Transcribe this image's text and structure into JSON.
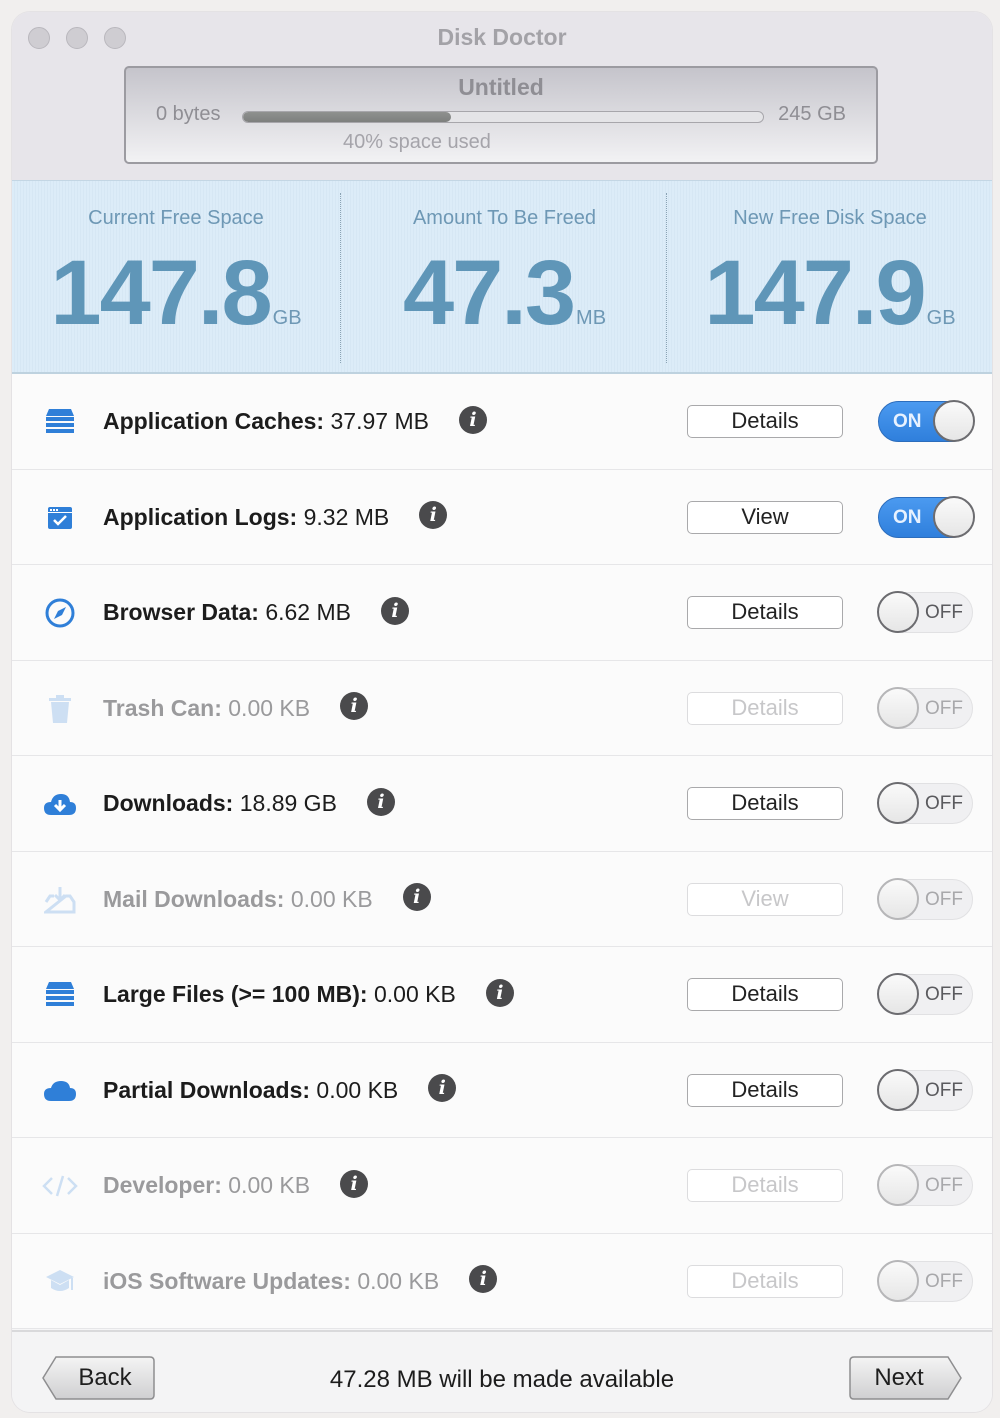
{
  "window": {
    "title": "Disk Doctor"
  },
  "disk": {
    "name": "Untitled",
    "min_label": "0 bytes",
    "max_label": "245 GB",
    "used_fraction": 0.4,
    "used_label": "40% space used"
  },
  "stats": [
    {
      "label": "Current Free Space",
      "value": "147.8",
      "unit": "GB"
    },
    {
      "label": "Amount To Be Freed",
      "value": "47.3",
      "unit": "MB"
    },
    {
      "label": "New Free Disk Space",
      "value": "147.9",
      "unit": "GB"
    }
  ],
  "items": [
    {
      "name": "Application Caches:",
      "size": " 37.97 MB",
      "icon": "server-stack-icon",
      "button": "Details",
      "toggle": "ON",
      "enabled": true
    },
    {
      "name": "Application Logs:",
      "size": " 9.32 MB",
      "icon": "checked-window-icon",
      "button": "View",
      "toggle": "ON",
      "enabled": true
    },
    {
      "name": "Browser Data:",
      "size": " 6.62 MB",
      "icon": "compass-icon",
      "button": "Details",
      "toggle": "OFF",
      "enabled": true
    },
    {
      "name": "Trash Can:",
      "size": " 0.00 KB",
      "icon": "trash-icon",
      "button": "Details",
      "toggle": "OFF",
      "enabled": false
    },
    {
      "name": "Downloads:",
      "size": " 18.89 GB",
      "icon": "cloud-download-icon",
      "button": "Details",
      "toggle": "OFF",
      "enabled": true
    },
    {
      "name": "Mail Downloads:",
      "size": " 0.00 KB",
      "icon": "tray-download-icon",
      "button": "View",
      "toggle": "OFF",
      "enabled": false
    },
    {
      "name": "Large Files (>= 100 MB):",
      "size": " 0.00 KB",
      "icon": "server-stack-icon",
      "button": "Details",
      "toggle": "OFF",
      "enabled": true
    },
    {
      "name": "Partial Downloads:",
      "size": " 0.00 KB",
      "icon": "cloud-icon",
      "button": "Details",
      "toggle": "OFF",
      "enabled": true
    },
    {
      "name": "Developer:",
      "size": " 0.00 KB",
      "icon": "code-icon",
      "button": "Details",
      "toggle": "OFF",
      "enabled": false
    },
    {
      "name": "iOS Software Updates:",
      "size": " 0.00 KB",
      "icon": "graduation-cap-icon",
      "button": "Details",
      "toggle": "OFF",
      "enabled": false
    }
  ],
  "info_glyph": "i",
  "footer": {
    "back_label": "Back",
    "message": "47.28 MB will be made available",
    "next_label": "Next"
  },
  "colors": {
    "accent": "#3a8be6",
    "stat_text": "#5f96b8",
    "stats_bg": "#dcecf8"
  }
}
